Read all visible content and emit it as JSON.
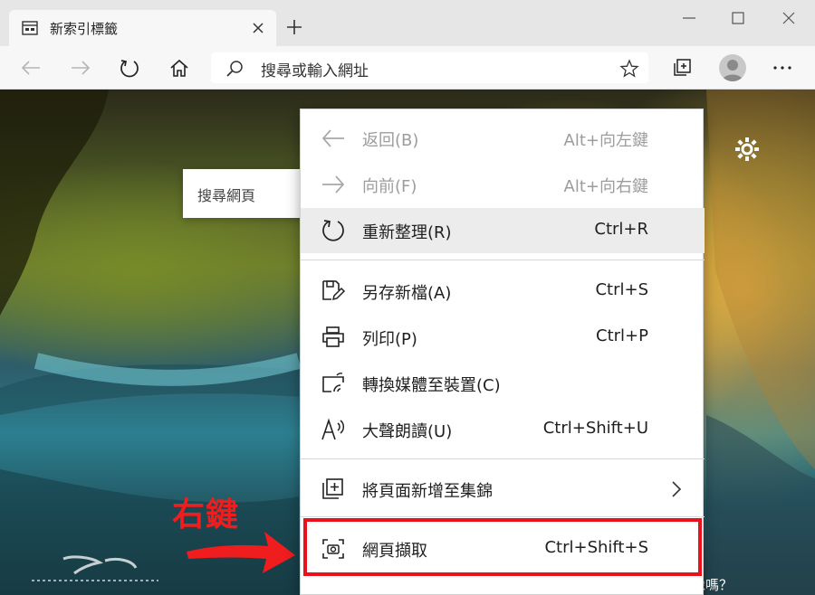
{
  "tab": {
    "title": "新索引標籤",
    "icon": "newtab-page-icon",
    "close_icon": "close-icon"
  },
  "window": {
    "minimize_icon": "minimize-icon",
    "maximize_icon": "maximize-icon",
    "close_icon": "close-icon"
  },
  "address_bar": {
    "placeholder": "搜尋或輸入網址",
    "search_icon": "search-icon",
    "favorite_icon": "star-icon"
  },
  "page": {
    "search_box_label": "搜尋網頁",
    "bottom_text": "像嗎？"
  },
  "annotation": {
    "text": "右鍵",
    "color": "#ef1d1d"
  },
  "context_menu": {
    "items": [
      {
        "label": "返回(B)",
        "shortcut": "Alt+向左鍵",
        "icon": "back-arrow-icon",
        "disabled": true
      },
      {
        "label": "向前(F)",
        "shortcut": "Alt+向右鍵",
        "icon": "forward-arrow-icon",
        "disabled": true
      },
      {
        "label": "重新整理(R)",
        "shortcut": "Ctrl+R",
        "icon": "refresh-icon",
        "disabled": false
      },
      {
        "label": "另存新檔(A)",
        "shortcut": "Ctrl+S",
        "icon": "save-icon",
        "disabled": false
      },
      {
        "label": "列印(P)",
        "shortcut": "Ctrl+P",
        "icon": "printer-icon",
        "disabled": false
      },
      {
        "label": "轉換媒體至裝置(C)",
        "shortcut": "",
        "icon": "cast-icon",
        "disabled": false
      },
      {
        "label": "大聲朗讀(U)",
        "shortcut": "Ctrl+Shift+U",
        "icon": "read-aloud-icon",
        "disabled": false
      },
      {
        "label": "將頁面新增至集錦",
        "shortcut": "",
        "icon": "add-to-collection-icon",
        "disabled": false
      },
      {
        "label": "網頁擷取",
        "shortcut": "Ctrl+Shift+S",
        "icon": "web-capture-icon",
        "disabled": false
      }
    ]
  },
  "colors": {
    "highlight_box": "#e8111c",
    "menu_hover": "#ececec",
    "disabled_text": "#9c9c9c"
  }
}
